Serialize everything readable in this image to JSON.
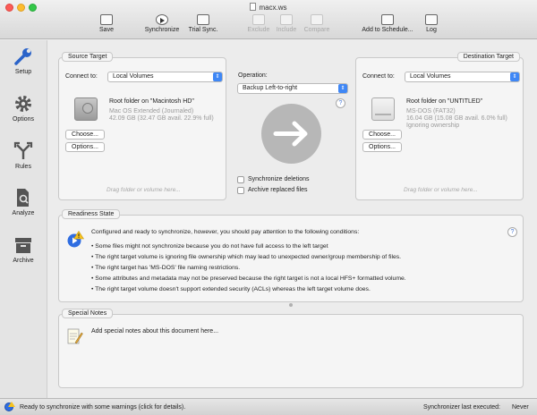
{
  "window": {
    "title": "macx.ws"
  },
  "toolbar": {
    "save": "Save",
    "synchronize": "Synchronize",
    "trial_sync": "Trial Sync.",
    "exclude": "Exclude",
    "include": "Include",
    "compare": "Compare",
    "add_to_schedule": "Add to Schedule...",
    "log": "Log"
  },
  "sidebar": {
    "items": [
      {
        "label": "Setup",
        "icon": "wrench-icon",
        "active": true
      },
      {
        "label": "Options",
        "icon": "gear-icon",
        "active": false
      },
      {
        "label": "Rules",
        "icon": "fork-arrows-icon",
        "active": false
      },
      {
        "label": "Analyze",
        "icon": "document-search-icon",
        "active": false
      },
      {
        "label": "Archive",
        "icon": "archive-box-icon",
        "active": false
      }
    ]
  },
  "source": {
    "tab": "Source Target",
    "connect_label": "Connect to:",
    "connect_value": "Local Volumes",
    "folder_title": "Root folder on \"Macintosh HD\"",
    "details": [
      "Mac OS Extended (Journaled)",
      "42.09 GB (32.47 GB avail. 22.9% full)"
    ],
    "choose": "Choose...",
    "options": "Options...",
    "drop_hint": "Drag folder or volume here..."
  },
  "operation": {
    "label": "Operation:",
    "value": "Backup Left-to-right",
    "sync_deletions": "Synchronize deletions",
    "archive_replaced": "Archive replaced files",
    "help": "?"
  },
  "destination": {
    "tab": "Destination Target",
    "connect_label": "Connect to:",
    "connect_value": "Local Volumes",
    "folder_title": "Root folder on \"UNTITLED\"",
    "details": [
      "MS-DOS (FAT32)",
      "16.04 GB (15.08 GB avail. 6.0% full)",
      "Ignoring ownership"
    ],
    "choose": "Choose...",
    "options": "Options...",
    "drop_hint": "Drag folder or volume here..."
  },
  "readiness": {
    "tab": "Readiness State",
    "headline": "Configured and ready to synchronize, however, you should pay attention to the following conditions:",
    "bullets": [
      "• Some files might not synchronize because you do not have full access to the left target",
      "• The right target volume is ignoring file ownership which may lead to unexpected owner/group membership of files.",
      "• The right target has 'MS-DOS' file naming restrictions.",
      "• Some attributes and metadata may not be preserved because the right target is not a local HFS+ formatted volume.",
      "• The right target volume doesn't support extended security (ACLs) whereas the left target volume does."
    ],
    "help": "?"
  },
  "notes": {
    "tab": "Special Notes",
    "placeholder": "Add special notes about this document here..."
  },
  "status": {
    "message": "Ready to synchronize with some warnings (click for details).",
    "last_executed_label": "Synchronizer last executed:",
    "last_executed_value": "Never"
  },
  "colors": {
    "accent": "#3f87f5",
    "warning": "#f6c21e"
  }
}
